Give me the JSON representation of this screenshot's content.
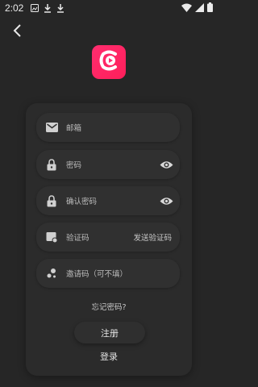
{
  "status": {
    "time": "2:02"
  },
  "form": {
    "email_placeholder": "邮箱",
    "password_placeholder": "密码",
    "confirm_password_placeholder": "确认密码",
    "code_placeholder": "验证码",
    "send_code_label": "发送验证码",
    "invite_placeholder": "邀请码（可不填）",
    "forgot_label": "忘记密码?",
    "register_label": "注册",
    "login_label": "登录"
  },
  "colors": {
    "background": "#262626",
    "card": "#2b2b2b",
    "brand": "#ff2d6f"
  },
  "icons": [
    "back-arrow",
    "email",
    "lock",
    "lock",
    "verify-shield",
    "invite",
    "eye",
    "eye"
  ]
}
